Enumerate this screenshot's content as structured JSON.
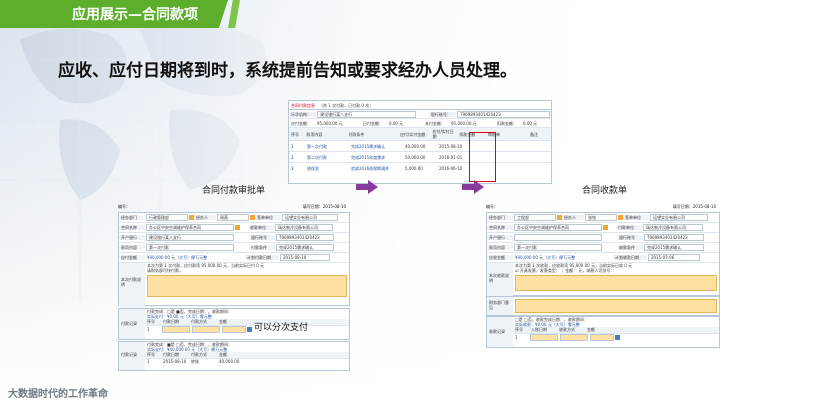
{
  "slide": {
    "section_title": "应用展示—合同款项",
    "headline": "应收、应付日期将到时，系统提前告知或要求经办人员处理。",
    "footer_logo": "大数据时代的工作革命"
  },
  "top_form": {
    "tabs": [
      "合同付款信息",
      "（合",
      "1",
      "次付款，已付款",
      "0",
      "次）"
    ],
    "payee_label": "乐华机构：",
    "payee_value": "建设银行某八支行",
    "account_label": "银行账号：",
    "account_value": "7969893401420423",
    "due_label": "应付金额：",
    "due_value": "95,000.00 元",
    "paid_label": "已付金额：",
    "paid_value": "0.00 元",
    "unpaid_label": "未付金额：",
    "unpaid_value": "95,000.00 元",
    "deduct_label": "扣款金额：",
    "deduct_value": "0.00 元",
    "columns": [
      "序号",
      "款项内容",
      "付款条件",
      "应付/实付金额",
      "应付/实付日期",
      "扣款金额",
      "审批单",
      "备注"
    ],
    "rows": [
      {
        "no": "1",
        "item": "第一次付款",
        "cond": "完成2015需求确认",
        "amount": "40,000.00",
        "date": "2015-08-10"
      },
      {
        "no": "2",
        "item": "第二次付款",
        "cond": "完成2015年度需求",
        "amount": "50,000.00",
        "date": "2016-01-01"
      },
      {
        "no": "3",
        "item": "质保金",
        "cond": "验收2016质保期满并",
        "amount": "5,000.00",
        "date": "2016-06-10"
      }
    ],
    "highlight_header": "应付/实付日期"
  },
  "left_caption": "合同付款审批单",
  "right_caption": "合同收款单",
  "left_form": {
    "number_label": "编号：",
    "fill_date_label": "填写日期：",
    "fill_date": "2015-08-10",
    "handler_dept_label": "经办部门",
    "handler_dept": "行政管理部",
    "handler_label": "经办人",
    "handler": "周燕",
    "sign_unit_label": "签单单位",
    "sign_unit": "运望实业有限公司",
    "contract_label": "合同名称",
    "contract": "办公区中央空调维护保养合同",
    "party_label": "收款单位",
    "party": "瑞达制冷设备有限公司",
    "bank_label": "开户银行",
    "bank": "建设银行某八支行",
    "acct_label": "银行账号",
    "acct": "7969893401420423",
    "item_label": "款项内容",
    "item": "第一次付款",
    "cond_label": "付款条件",
    "cond": "完成2015需求确认",
    "amount_label": "应付金额",
    "amount": "¥40,000.00 元（大写）肆万元整",
    "plan_date_label": "计划付款日期",
    "plan_date": "2015-08-10",
    "desc_label": "本次付款说明",
    "desc_line1": "本次为第 1 次付款，应付款项 95,000.00 元，当前实际已付 0 元",
    "desc_line2": "请财务部尽快付款。",
    "record_label": "付款记录",
    "record_line1": "付款完成：□是 ■否，完成日期：，收款期间：",
    "record_line2": "实际支付：¥0.00 元（大写）零元整",
    "record_cols": [
      "序号",
      "付款日期",
      "付款方式",
      "金额"
    ],
    "note_overlay": "可以分次支付",
    "record2_label": "付款记录",
    "record2_line1": "付款完成：■是 □否，完成日期：，收款期间：",
    "record2_line2": "实际支付：¥40,000.00 元（大写）肆万元整",
    "record2_row": [
      "1",
      "2015-08-10",
      "转账",
      "40,000.00"
    ]
  },
  "right_form": {
    "number_label": "编号：",
    "fill_date_label": "填写日期：",
    "fill_date": "2015-08-10",
    "handler_dept_label": "经办部门",
    "handler_dept": "工程部",
    "handler_label": "经办人",
    "handler": "张铭",
    "sign_unit_label": "签单单位",
    "sign_unit": "运望实业有限公司",
    "contract_label": "合同名称",
    "contract": "办公区中央空调维护保养合同",
    "party_label": "付款单位",
    "party": "瑞达制冷设备有限公司",
    "bank_label": "开户银行",
    "acct_label": "银行账号",
    "acct": "7969893401420423",
    "item_label": "款项内容",
    "item": "第一次付款",
    "cond_label": "收款条件",
    "cond": "完成2015需求确认",
    "amount_label": "应收金额",
    "amount": "¥40,000.00 元（大写）肆万元整",
    "plan_date_label": "计划收款日期",
    "plan_date": "2015-07-06",
    "desc_label": "本次收款说明",
    "desc_line1": "本次为第 1 次收款，应收款项 95,000.00 元，当前实际已收 0 元",
    "desc_line2": "☑ 开具发票，发票类型：    ；金额：    元，纳税人识别号：",
    "finance_label": "财务部门意见",
    "record_label": "收款记录",
    "record_line1": "□是 □否，收款完成日期：，收款期间：",
    "record_line2": "实际收款：¥0.00 元（大写）零元整",
    "record_cols": [
      "序号",
      "入账日期",
      "收款方式",
      "金额"
    ]
  }
}
